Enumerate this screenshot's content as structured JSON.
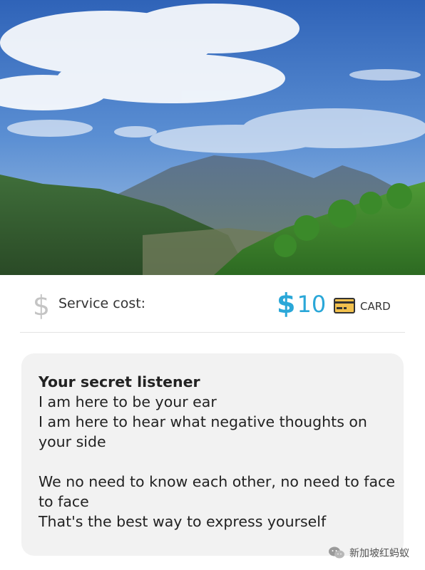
{
  "service": {
    "cost_label": "Service cost:",
    "currency_symbol": "$",
    "price": "10",
    "payment_method": "CARD",
    "icon": "dollar-icon",
    "accent_color": "#2aa7d8"
  },
  "message": {
    "title": "Your secret listener",
    "lines": [
      "I am here to be your ear",
      "I am here to hear what negative thoughts on",
      "your side",
      "",
      "We no need to know each other, no need to face",
      "to face",
      "That's the best way to express yourself"
    ]
  },
  "watermark": {
    "text": "新加坡红蚂蚁",
    "icon": "wechat-icon"
  }
}
